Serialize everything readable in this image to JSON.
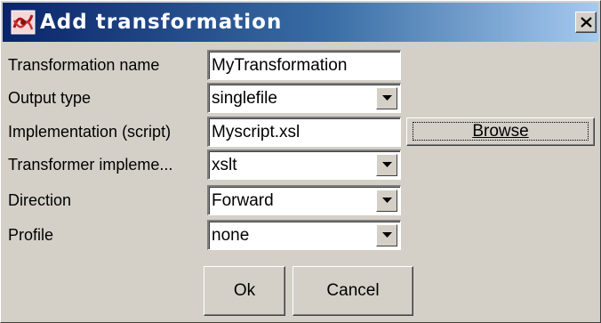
{
  "window": {
    "title": "Add transformation",
    "icon": "app-icon"
  },
  "form": {
    "rows": [
      {
        "label": "Transformation name",
        "value": "MyTransformation",
        "kind": "text"
      },
      {
        "label": "Output type",
        "value": "singlefile",
        "kind": "combo"
      },
      {
        "label": "Implementation (script)",
        "value": "Myscript.xsl",
        "kind": "text"
      },
      {
        "label": "Transformer impleme...",
        "value": "xslt",
        "kind": "combo"
      },
      {
        "label": "Direction",
        "value": "Forward",
        "kind": "combo"
      },
      {
        "label": "Profile",
        "value": "none",
        "kind": "combo"
      }
    ],
    "browse_label": "Browse"
  },
  "buttons": {
    "ok_label": "Ok",
    "cancel_label": "Cancel"
  },
  "icons": {
    "close": "close-icon",
    "dropdown": "chevron-down-icon"
  }
}
